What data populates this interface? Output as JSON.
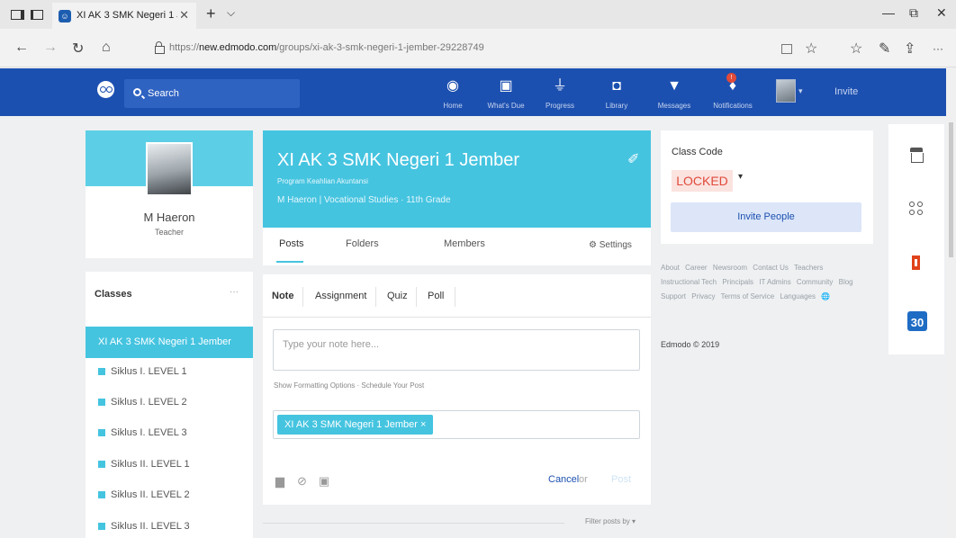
{
  "browser": {
    "tab_title": "XI AK 3 SMK Negeri 1 Je",
    "tab_close": "✕",
    "new_tab": "+",
    "tab_menu": "⌵",
    "url_prefix": "https://",
    "url_domain": "new.edmodo.com",
    "url_path": "/groups/xi-ak-3-smk-negeri-1-jember-29228749",
    "window_controls": {
      "minimize": "—",
      "restore": "⧉",
      "close": "✕"
    },
    "nav": {
      "back": "←",
      "forward": "→",
      "refresh": "↻",
      "home": "⌂"
    },
    "icons": [
      "reading-view-icon",
      "favorite-star-icon",
      "favorites-hub-icon",
      "pen-icon",
      "share-icon",
      "more-icon"
    ],
    "more": "···"
  },
  "header": {
    "search_placeholder": "Search",
    "nav_items": [
      {
        "label": "Home",
        "icon": "home-icon"
      },
      {
        "label": "What's Due",
        "icon": "clipboard-icon"
      },
      {
        "label": "Progress",
        "icon": "pulse-icon"
      },
      {
        "label": "Library",
        "icon": "library-icon"
      },
      {
        "label": "Messages",
        "icon": "messages-icon"
      },
      {
        "label": "Notifications",
        "icon": "bell-icon"
      }
    ],
    "notification_count": "!",
    "invite": "Invite"
  },
  "profile": {
    "name": "M Haeron",
    "role": "Teacher"
  },
  "classes": {
    "title": "Classes",
    "more": "···",
    "active": "XI AK 3 SMK Negeri 1 Jember",
    "items": [
      "Siklus I. LEVEL 1",
      "Siklus I. LEVEL 2",
      "Siklus I. LEVEL 3",
      "Siklus II. LEVEL 1",
      "Siklus II. LEVEL 2",
      "Siklus II. LEVEL 3"
    ]
  },
  "group": {
    "title": "XI AK 3 SMK Negeri 1 Jember",
    "subtitle": "Program Keahlian Akuntansi",
    "meta": "M Haeron | Vocational Studies · 11th Grade",
    "tabs": [
      "Posts",
      "Folders",
      "Members"
    ],
    "settings": "Settings"
  },
  "composer": {
    "tabs": [
      "Note",
      "Assignment",
      "Quiz",
      "Poll"
    ],
    "placeholder": "Type your note here...",
    "formatting": "Show Formatting Options · Schedule Your Post",
    "recipient": "XI AK 3 SMK Negeri 1 Jember",
    "cancel": "Cancel",
    "or": "or",
    "post": "Post",
    "filter": "Filter posts by ▾"
  },
  "class_code": {
    "label": "Class Code",
    "status": "LOCKED",
    "caret": "▾",
    "invite_button": "Invite People"
  },
  "footer": {
    "links": [
      "About",
      "Career",
      "Newsroom",
      "Contact Us",
      "Teachers",
      "Instructional Tech",
      "Principals",
      "IT Admins",
      "Community",
      "Blog",
      "Support",
      "Privacy",
      "Terms of Service",
      "Languages"
    ],
    "copyright": "Edmodo © 2019"
  },
  "app_rail": {
    "calendar_day": "30"
  },
  "colors": {
    "brand_blue": "#1c50b0",
    "group_cyan": "#45c4e0",
    "locked_red": "#e04a3a"
  }
}
